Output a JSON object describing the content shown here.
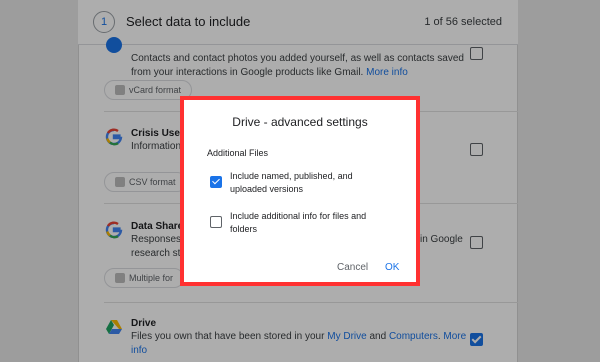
{
  "step": {
    "number": "1",
    "title": "Select data to include",
    "count": "1 of 56 selected"
  },
  "products": [
    {
      "name": "",
      "desc_line1": "Contacts and contact photos you added yourself, as well as contacts saved",
      "desc_line2": "from your interactions in Google products like Gmail.",
      "more": "More info",
      "chip": "vCard format",
      "checked": false
    },
    {
      "name": "Crisis User",
      "desc_line1": "Information",
      "chip": "CSV format",
      "checked": false
    },
    {
      "name": "Data Share",
      "desc_line1": "Responses",
      "desc_line1_tail": "in Google",
      "desc_line2": "research st",
      "chip": "Multiple for",
      "checked": false
    },
    {
      "name": "Drive",
      "desc_prefix": "Files you own that have been stored in your ",
      "link1": "My Drive",
      "desc_and": " and ",
      "link2": "Computers",
      "more": "More",
      "desc_line2": "info",
      "checked": true
    }
  ],
  "dialog": {
    "title": "Drive - advanced settings",
    "section": "Additional Files",
    "options": [
      {
        "label": "Include named, published, and uploaded versions",
        "checked": true
      },
      {
        "label": "Include additional info for files and folders",
        "checked": false
      }
    ],
    "cancel": "Cancel",
    "ok": "OK"
  },
  "colors": {
    "accent": "#1a73e8",
    "highlight_border": "#ff3131"
  }
}
